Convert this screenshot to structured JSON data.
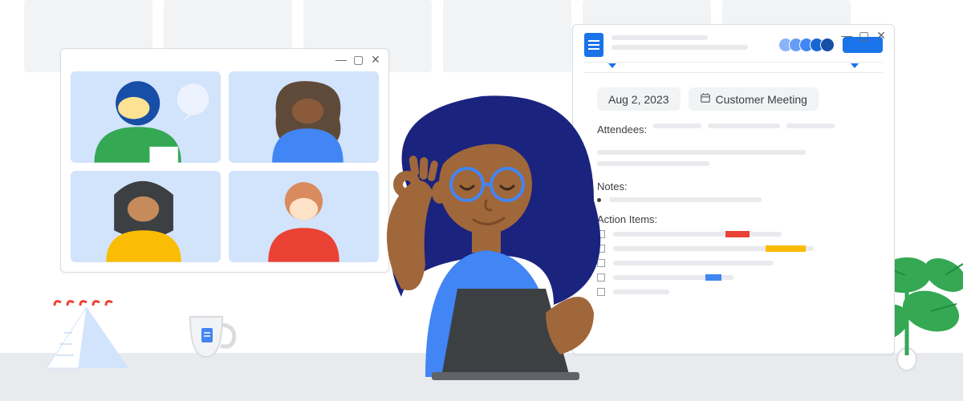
{
  "docs": {
    "date_chip": "Aug 2, 2023",
    "meeting_chip": "Customer Meeting",
    "attendees_label": "Attendees:",
    "notes_label": "Notes:",
    "action_items_label": "Action Items:",
    "avatar_colors": [
      "#8ab4f8",
      "#1a73e8",
      "#4285f4",
      "#174ea6"
    ],
    "highlights": {
      "red": "#ea4335",
      "yellow": "#fbbc04",
      "blue": "#4285f4"
    }
  },
  "video": {
    "participants": 4
  }
}
